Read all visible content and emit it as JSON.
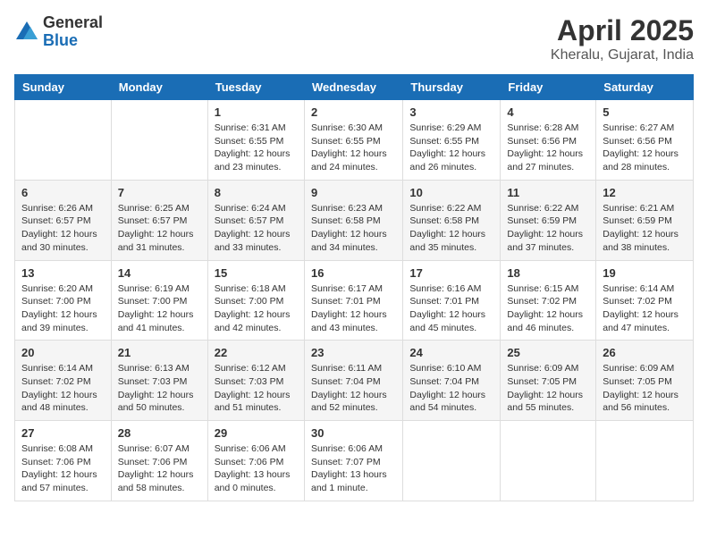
{
  "header": {
    "logo_general": "General",
    "logo_blue": "Blue",
    "month": "April 2025",
    "location": "Kheralu, Gujarat, India"
  },
  "weekdays": [
    "Sunday",
    "Monday",
    "Tuesday",
    "Wednesday",
    "Thursday",
    "Friday",
    "Saturday"
  ],
  "weeks": [
    [
      {
        "day": "",
        "sunrise": "",
        "sunset": "",
        "daylight": ""
      },
      {
        "day": "",
        "sunrise": "",
        "sunset": "",
        "daylight": ""
      },
      {
        "day": "1",
        "sunrise": "Sunrise: 6:31 AM",
        "sunset": "Sunset: 6:55 PM",
        "daylight": "Daylight: 12 hours and 23 minutes."
      },
      {
        "day": "2",
        "sunrise": "Sunrise: 6:30 AM",
        "sunset": "Sunset: 6:55 PM",
        "daylight": "Daylight: 12 hours and 24 minutes."
      },
      {
        "day": "3",
        "sunrise": "Sunrise: 6:29 AM",
        "sunset": "Sunset: 6:55 PM",
        "daylight": "Daylight: 12 hours and 26 minutes."
      },
      {
        "day": "4",
        "sunrise": "Sunrise: 6:28 AM",
        "sunset": "Sunset: 6:56 PM",
        "daylight": "Daylight: 12 hours and 27 minutes."
      },
      {
        "day": "5",
        "sunrise": "Sunrise: 6:27 AM",
        "sunset": "Sunset: 6:56 PM",
        "daylight": "Daylight: 12 hours and 28 minutes."
      }
    ],
    [
      {
        "day": "6",
        "sunrise": "Sunrise: 6:26 AM",
        "sunset": "Sunset: 6:57 PM",
        "daylight": "Daylight: 12 hours and 30 minutes."
      },
      {
        "day": "7",
        "sunrise": "Sunrise: 6:25 AM",
        "sunset": "Sunset: 6:57 PM",
        "daylight": "Daylight: 12 hours and 31 minutes."
      },
      {
        "day": "8",
        "sunrise": "Sunrise: 6:24 AM",
        "sunset": "Sunset: 6:57 PM",
        "daylight": "Daylight: 12 hours and 33 minutes."
      },
      {
        "day": "9",
        "sunrise": "Sunrise: 6:23 AM",
        "sunset": "Sunset: 6:58 PM",
        "daylight": "Daylight: 12 hours and 34 minutes."
      },
      {
        "day": "10",
        "sunrise": "Sunrise: 6:22 AM",
        "sunset": "Sunset: 6:58 PM",
        "daylight": "Daylight: 12 hours and 35 minutes."
      },
      {
        "day": "11",
        "sunrise": "Sunrise: 6:22 AM",
        "sunset": "Sunset: 6:59 PM",
        "daylight": "Daylight: 12 hours and 37 minutes."
      },
      {
        "day": "12",
        "sunrise": "Sunrise: 6:21 AM",
        "sunset": "Sunset: 6:59 PM",
        "daylight": "Daylight: 12 hours and 38 minutes."
      }
    ],
    [
      {
        "day": "13",
        "sunrise": "Sunrise: 6:20 AM",
        "sunset": "Sunset: 7:00 PM",
        "daylight": "Daylight: 12 hours and 39 minutes."
      },
      {
        "day": "14",
        "sunrise": "Sunrise: 6:19 AM",
        "sunset": "Sunset: 7:00 PM",
        "daylight": "Daylight: 12 hours and 41 minutes."
      },
      {
        "day": "15",
        "sunrise": "Sunrise: 6:18 AM",
        "sunset": "Sunset: 7:00 PM",
        "daylight": "Daylight: 12 hours and 42 minutes."
      },
      {
        "day": "16",
        "sunrise": "Sunrise: 6:17 AM",
        "sunset": "Sunset: 7:01 PM",
        "daylight": "Daylight: 12 hours and 43 minutes."
      },
      {
        "day": "17",
        "sunrise": "Sunrise: 6:16 AM",
        "sunset": "Sunset: 7:01 PM",
        "daylight": "Daylight: 12 hours and 45 minutes."
      },
      {
        "day": "18",
        "sunrise": "Sunrise: 6:15 AM",
        "sunset": "Sunset: 7:02 PM",
        "daylight": "Daylight: 12 hours and 46 minutes."
      },
      {
        "day": "19",
        "sunrise": "Sunrise: 6:14 AM",
        "sunset": "Sunset: 7:02 PM",
        "daylight": "Daylight: 12 hours and 47 minutes."
      }
    ],
    [
      {
        "day": "20",
        "sunrise": "Sunrise: 6:14 AM",
        "sunset": "Sunset: 7:02 PM",
        "daylight": "Daylight: 12 hours and 48 minutes."
      },
      {
        "day": "21",
        "sunrise": "Sunrise: 6:13 AM",
        "sunset": "Sunset: 7:03 PM",
        "daylight": "Daylight: 12 hours and 50 minutes."
      },
      {
        "day": "22",
        "sunrise": "Sunrise: 6:12 AM",
        "sunset": "Sunset: 7:03 PM",
        "daylight": "Daylight: 12 hours and 51 minutes."
      },
      {
        "day": "23",
        "sunrise": "Sunrise: 6:11 AM",
        "sunset": "Sunset: 7:04 PM",
        "daylight": "Daylight: 12 hours and 52 minutes."
      },
      {
        "day": "24",
        "sunrise": "Sunrise: 6:10 AM",
        "sunset": "Sunset: 7:04 PM",
        "daylight": "Daylight: 12 hours and 54 minutes."
      },
      {
        "day": "25",
        "sunrise": "Sunrise: 6:09 AM",
        "sunset": "Sunset: 7:05 PM",
        "daylight": "Daylight: 12 hours and 55 minutes."
      },
      {
        "day": "26",
        "sunrise": "Sunrise: 6:09 AM",
        "sunset": "Sunset: 7:05 PM",
        "daylight": "Daylight: 12 hours and 56 minutes."
      }
    ],
    [
      {
        "day": "27",
        "sunrise": "Sunrise: 6:08 AM",
        "sunset": "Sunset: 7:06 PM",
        "daylight": "Daylight: 12 hours and 57 minutes."
      },
      {
        "day": "28",
        "sunrise": "Sunrise: 6:07 AM",
        "sunset": "Sunset: 7:06 PM",
        "daylight": "Daylight: 12 hours and 58 minutes."
      },
      {
        "day": "29",
        "sunrise": "Sunrise: 6:06 AM",
        "sunset": "Sunset: 7:06 PM",
        "daylight": "Daylight: 13 hours and 0 minutes."
      },
      {
        "day": "30",
        "sunrise": "Sunrise: 6:06 AM",
        "sunset": "Sunset: 7:07 PM",
        "daylight": "Daylight: 13 hours and 1 minute."
      },
      {
        "day": "",
        "sunrise": "",
        "sunset": "",
        "daylight": ""
      },
      {
        "day": "",
        "sunrise": "",
        "sunset": "",
        "daylight": ""
      },
      {
        "day": "",
        "sunrise": "",
        "sunset": "",
        "daylight": ""
      }
    ]
  ]
}
